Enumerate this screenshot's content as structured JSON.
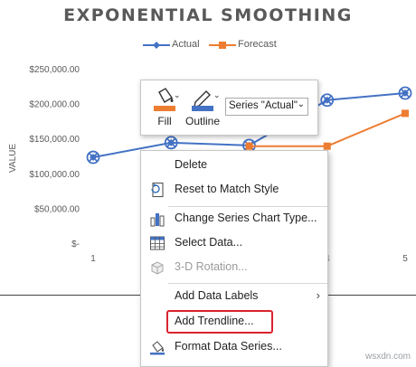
{
  "chart_data": {
    "type": "line",
    "title": "EXPONENTIAL SMOOTHING",
    "ylabel": "VALUE",
    "xlabel": "",
    "x": [
      1,
      2,
      3,
      4,
      5
    ],
    "x_tick_labels": [
      "1",
      "",
      "",
      "4",
      "5"
    ],
    "y_tick_labels": [
      "$250,000.00",
      "$200,000.00",
      "$150,000.00",
      "$100,000.00",
      "$50,000.00",
      "$-"
    ],
    "ylim": [
      0,
      250000
    ],
    "series": [
      {
        "name": "Actual",
        "color": "#4472c4",
        "marker": "diamond",
        "values": [
          123000,
          144000,
          140000,
          205000,
          215000
        ]
      },
      {
        "name": "Forecast",
        "color": "#ed7d31",
        "marker": "square",
        "values": [
          null,
          null,
          139000,
          139000,
          186000
        ]
      }
    ],
    "legend": "top",
    "grid": false
  },
  "toolbar": {
    "fill_label": "Fill",
    "outline_label": "Outline",
    "series_select_value": "Series \"Actual\"",
    "fill_color": "#ed7d31",
    "outline_color": "#4472c4"
  },
  "context_menu": {
    "items": [
      {
        "label": "Delete",
        "icon": "none"
      },
      {
        "label": "Reset to Match Style",
        "icon": "reset-style-icon"
      },
      {
        "label": "Change Series Chart Type...",
        "icon": "bar-chart-icon"
      },
      {
        "label": "Select Data...",
        "icon": "table-data-icon"
      },
      {
        "label": "3-D Rotation...",
        "icon": "cube-3d-icon",
        "disabled": true
      },
      {
        "label": "Add Data Labels",
        "icon": "none",
        "submenu": true
      },
      {
        "label": "Add Trendline...",
        "icon": "none",
        "highlighted": true
      },
      {
        "label": "Format Data Series...",
        "icon": "paint-bucket-icon"
      }
    ]
  },
  "watermark": "wsxdn.com",
  "accent": "#d9232d"
}
